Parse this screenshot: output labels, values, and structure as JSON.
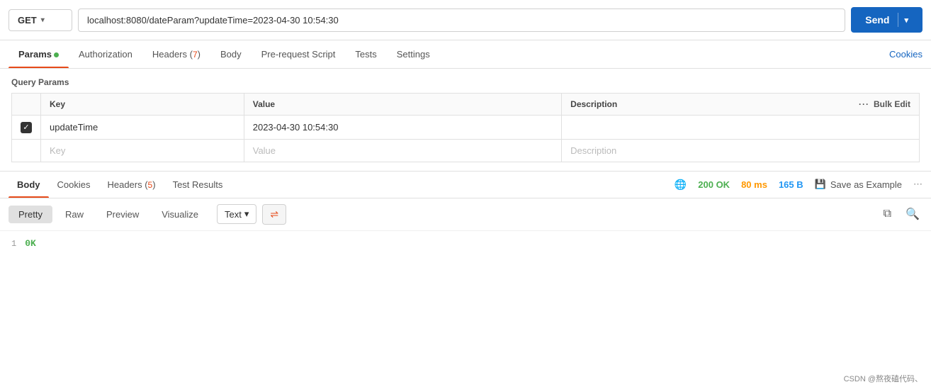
{
  "urlBar": {
    "method": "GET",
    "url": "localhost:8080/dateParam?updateTime=2023-04-30 10:54:30",
    "sendLabel": "Send"
  },
  "requestTabs": {
    "items": [
      {
        "id": "params",
        "label": "Params",
        "hasDot": true,
        "active": true
      },
      {
        "id": "authorization",
        "label": "Authorization",
        "hasDot": false,
        "active": false
      },
      {
        "id": "headers",
        "label": "Headers",
        "badge": "7",
        "active": false
      },
      {
        "id": "body",
        "label": "Body",
        "active": false
      },
      {
        "id": "prerequest",
        "label": "Pre-request Script",
        "active": false
      },
      {
        "id": "tests",
        "label": "Tests",
        "active": false
      },
      {
        "id": "settings",
        "label": "Settings",
        "active": false
      }
    ],
    "cookiesLabel": "Cookies"
  },
  "queryParams": {
    "title": "Query Params",
    "columns": {
      "key": "Key",
      "value": "Value",
      "description": "Description",
      "bulkEdit": "Bulk Edit"
    },
    "rows": [
      {
        "checked": true,
        "key": "updateTime",
        "value": "2023-04-30 10:54:30",
        "description": ""
      }
    ],
    "emptyRow": {
      "keyPlaceholder": "Key",
      "valuePlaceholder": "Value",
      "descriptionPlaceholder": "Description"
    }
  },
  "responseTabs": {
    "items": [
      {
        "id": "body",
        "label": "Body",
        "active": true
      },
      {
        "id": "cookies",
        "label": "Cookies",
        "active": false
      },
      {
        "id": "headers",
        "label": "Headers",
        "badge": "5",
        "active": false
      },
      {
        "id": "testresults",
        "label": "Test Results",
        "active": false
      }
    ],
    "meta": {
      "statusCode": "200",
      "statusText": "OK",
      "time": "80 ms",
      "size": "165 B"
    },
    "saveExampleLabel": "Save as Example"
  },
  "formatBar": {
    "buttons": [
      {
        "id": "pretty",
        "label": "Pretty",
        "active": true
      },
      {
        "id": "raw",
        "label": "Raw",
        "active": false
      },
      {
        "id": "preview",
        "label": "Preview",
        "active": false
      },
      {
        "id": "visualize",
        "label": "Visualize",
        "active": false
      }
    ],
    "textFormat": "Text"
  },
  "responseBody": {
    "lines": [
      {
        "num": "1",
        "content": "0K"
      }
    ]
  },
  "footer": {
    "text": "CSDN @熬夜磕代码、"
  }
}
